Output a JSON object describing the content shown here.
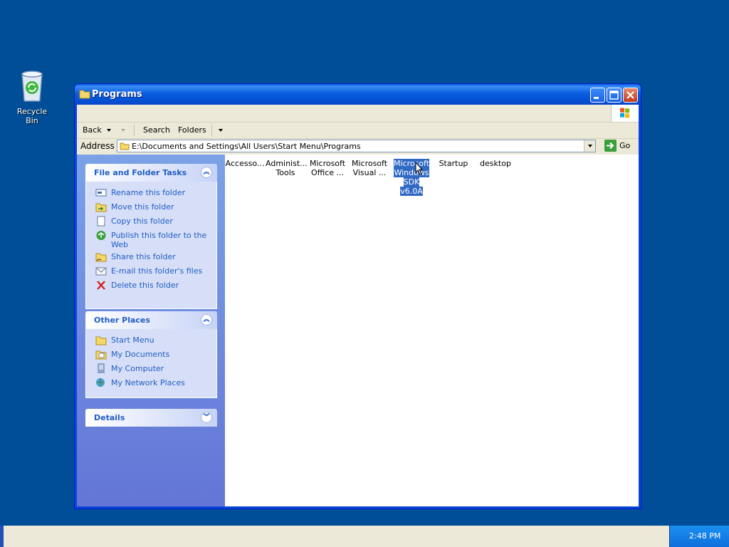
{
  "desktop": {
    "recycle_bin_label": "Recycle Bin"
  },
  "window": {
    "title": "Programs",
    "minimize_label": "Minimize",
    "maximize_label": "Maximize",
    "close_label": "Close"
  },
  "toolbar": {
    "back_label": "Back",
    "search_label": "Search",
    "folders_label": "Folders"
  },
  "address": {
    "label": "Address",
    "path": "E:\\Documents and Settings\\All Users\\Start Menu\\Programs",
    "go_label": "Go"
  },
  "file_folder_tasks": {
    "title": "File and Folder Tasks",
    "items": [
      {
        "label": "Rename this folder",
        "icon": "rename-icon"
      },
      {
        "label": "Move this folder",
        "icon": "move-icon"
      },
      {
        "label": "Copy this folder",
        "icon": "copy-icon"
      },
      {
        "label": "Publish this folder to the Web",
        "icon": "publish-web-icon"
      },
      {
        "label": "Share this folder",
        "icon": "share-icon"
      },
      {
        "label": "E-mail this folder's files",
        "icon": "email-icon"
      },
      {
        "label": "Delete this folder",
        "icon": "delete-icon"
      }
    ]
  },
  "other_places": {
    "title": "Other Places",
    "items": [
      {
        "label": "Start Menu",
        "icon": "folder-icon"
      },
      {
        "label": "My Documents",
        "icon": "my-documents-icon"
      },
      {
        "label": "My Computer",
        "icon": "my-computer-icon"
      },
      {
        "label": "My Network Places",
        "icon": "network-places-icon"
      }
    ]
  },
  "details": {
    "title": "Details"
  },
  "files": [
    {
      "line1": "Accesso...",
      "line2": "",
      "line3": "",
      "selected": false
    },
    {
      "line1": "Administ...",
      "line2": "Tools",
      "line3": "",
      "selected": false
    },
    {
      "line1": "Microsoft",
      "line2": "Office ...",
      "line3": "",
      "selected": false
    },
    {
      "line1": "Microsoft",
      "line2": "Visual ...",
      "line3": "",
      "selected": false
    },
    {
      "line1": "Microsoft",
      "line2": "Windows",
      "line3": "SDK v6.0A",
      "selected": true
    },
    {
      "line1": "Startup",
      "line2": "",
      "line3": "",
      "selected": false
    },
    {
      "line1": "desktop",
      "line2": "",
      "line3": "",
      "selected": false
    }
  ],
  "taskbar": {
    "time": "2:48 PM"
  },
  "colors": {
    "desktop": "#004e98",
    "titlebar": "#0a5fe0",
    "selection": "#316ac5",
    "task_link": "#215dc6"
  }
}
